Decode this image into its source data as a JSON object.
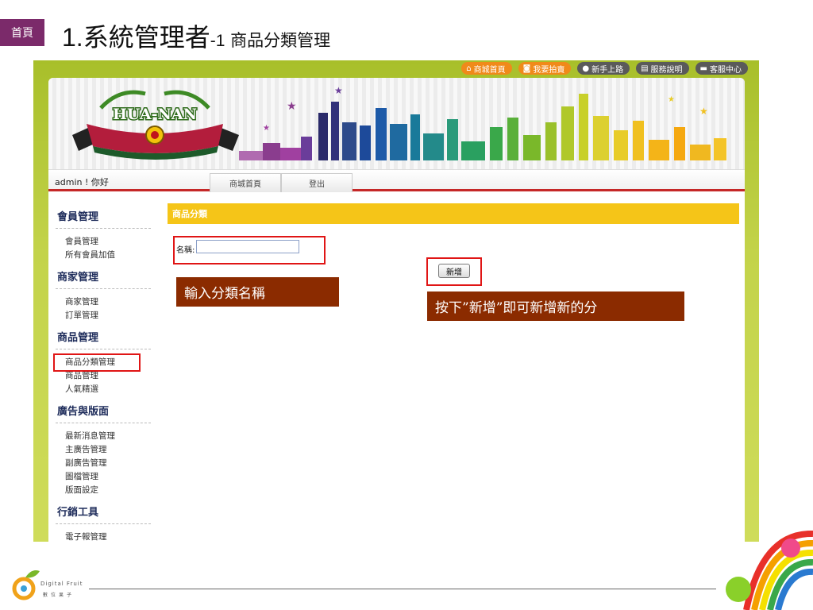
{
  "slide": {
    "home_tab": "首頁",
    "title_main": "系統管理者",
    "title_num": "1.",
    "title_dash": "-1",
    "title_sub": "商品分類管理"
  },
  "topnav": [
    {
      "label": "商城首頁",
      "icon": "home-icon"
    },
    {
      "label": "我要拍賣",
      "icon": "auction-icon"
    },
    {
      "label": "新手上路",
      "icon": "user-icon"
    },
    {
      "label": "服務說明",
      "icon": "book-icon"
    },
    {
      "label": "客服中心",
      "icon": "chat-icon"
    }
  ],
  "banner": {
    "logo_text": "HUA-NAN"
  },
  "userbar": {
    "greeting": "admin ! 你好",
    "tabs": [
      "商城首頁",
      "登出"
    ]
  },
  "sidebar": {
    "sections": [
      {
        "title": "會員管理",
        "items": [
          "會員管理",
          "所有會員加值"
        ]
      },
      {
        "title": "商家管理",
        "items": [
          "商家管理",
          "訂單管理"
        ]
      },
      {
        "title": "商品管理",
        "items": [
          "商品分類管理",
          "商品管理",
          "人氣精選"
        ]
      },
      {
        "title": "廣告與版面",
        "items": [
          "最新消息管理",
          "主廣告管理",
          "副廣告管理",
          "圖檔管理",
          "版面設定"
        ]
      },
      {
        "title": "行銷工具",
        "items": [
          "電子報管理"
        ]
      }
    ]
  },
  "content": {
    "section_title": "商品分類",
    "name_label": "名稱:",
    "name_value": "",
    "add_button": "新增"
  },
  "callouts": {
    "input_hint": "輸入分類名稱",
    "add_hint": "按下”新增”即可新增新的分"
  },
  "footer": {
    "brand_en": "Digital Fruit",
    "brand_zh": "數位果子"
  },
  "colors": {
    "home_tab": "#7b2a6a",
    "frame": "#b5c83a",
    "section_bar": "#f5c518",
    "callout": "#8b2b00",
    "highlight": "#e01515"
  }
}
